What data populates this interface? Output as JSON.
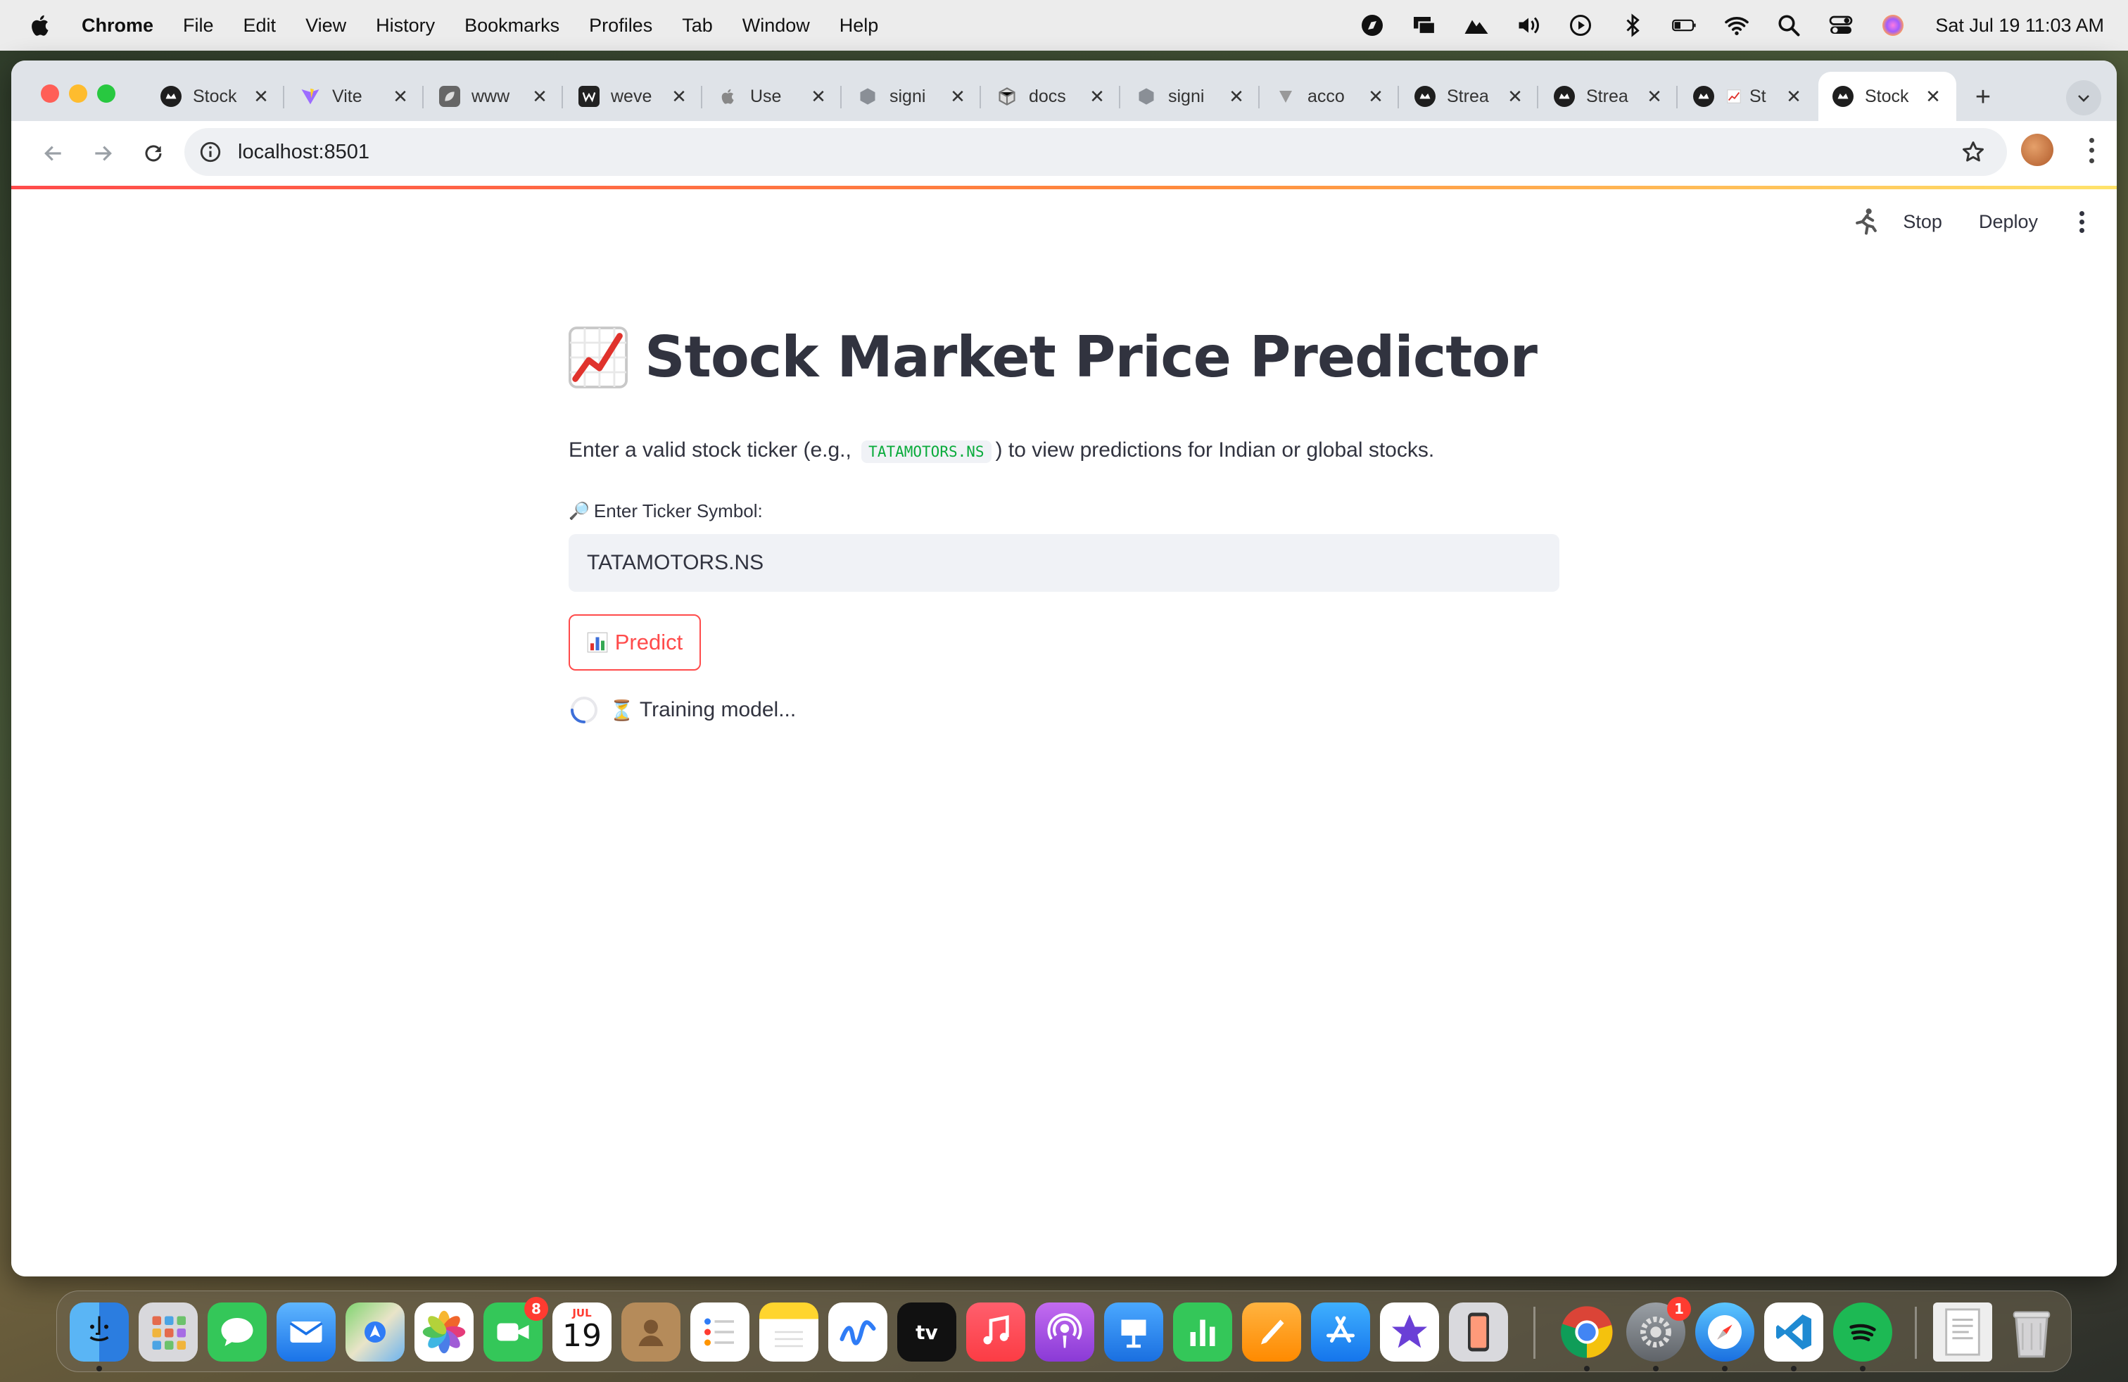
{
  "menubar": {
    "app_name": "Chrome",
    "items": [
      "File",
      "Edit",
      "View",
      "History",
      "Bookmarks",
      "Profiles",
      "Tab",
      "Window",
      "Help"
    ],
    "datetime": "Sat Jul 19  11:03 AM"
  },
  "browser": {
    "tabs": [
      {
        "title": "Stock",
        "icon": "streamlit-icon"
      },
      {
        "title": "Vite",
        "icon": "vite-icon"
      },
      {
        "title": "www",
        "icon": "leaf-icon"
      },
      {
        "title": "weve",
        "icon": "w-logo-icon"
      },
      {
        "title": "Use",
        "icon": "apple-icon"
      },
      {
        "title": "signi",
        "icon": "hexagon-icon"
      },
      {
        "title": "docs",
        "icon": "box-icon"
      },
      {
        "title": "signi",
        "icon": "hexagon-icon"
      },
      {
        "title": "acco",
        "icon": "triangle-icon"
      },
      {
        "title": "Strea",
        "icon": "streamlit-icon"
      },
      {
        "title": "Strea",
        "icon": "streamlit-icon"
      },
      {
        "title": "St",
        "icon": "streamlit-icon"
      },
      {
        "title": "Stock",
        "icon": "streamlit-icon",
        "active": true
      }
    ],
    "url": "localhost:8501"
  },
  "streamlit_header": {
    "stop_label": "Stop",
    "deploy_label": "Deploy"
  },
  "app": {
    "title": "Stock Market Price Predictor",
    "description_before": "Enter a valid stock ticker (e.g.,",
    "description_code": "TATAMOTORS.NS",
    "description_after": ") to view predictions for Indian or global stocks.",
    "input_label": "Enter Ticker Symbol:",
    "input_value": "TATAMOTORS.NS",
    "predict_label": "Predict",
    "spinner_text": "Training model...",
    "accent_color": "#ff4b4b"
  },
  "dock": {
    "apps": [
      "finder",
      "launchpad",
      "messages",
      "mail",
      "maps",
      "photos",
      "facetime",
      "calendar",
      "contacts",
      "reminders",
      "notes",
      "freeform",
      "tv",
      "music",
      "podcasts",
      "keynote",
      "numbers",
      "pages",
      "app-store",
      "imovie",
      "iphone-mirroring",
      "chrome",
      "system-settings",
      "safari",
      "vscode",
      "spotify",
      "downloads",
      "trash"
    ],
    "facetime_badge": "8",
    "settings_badge": "1",
    "calendar_month": "JUL",
    "calendar_day": "19",
    "tv_label": "tv"
  }
}
